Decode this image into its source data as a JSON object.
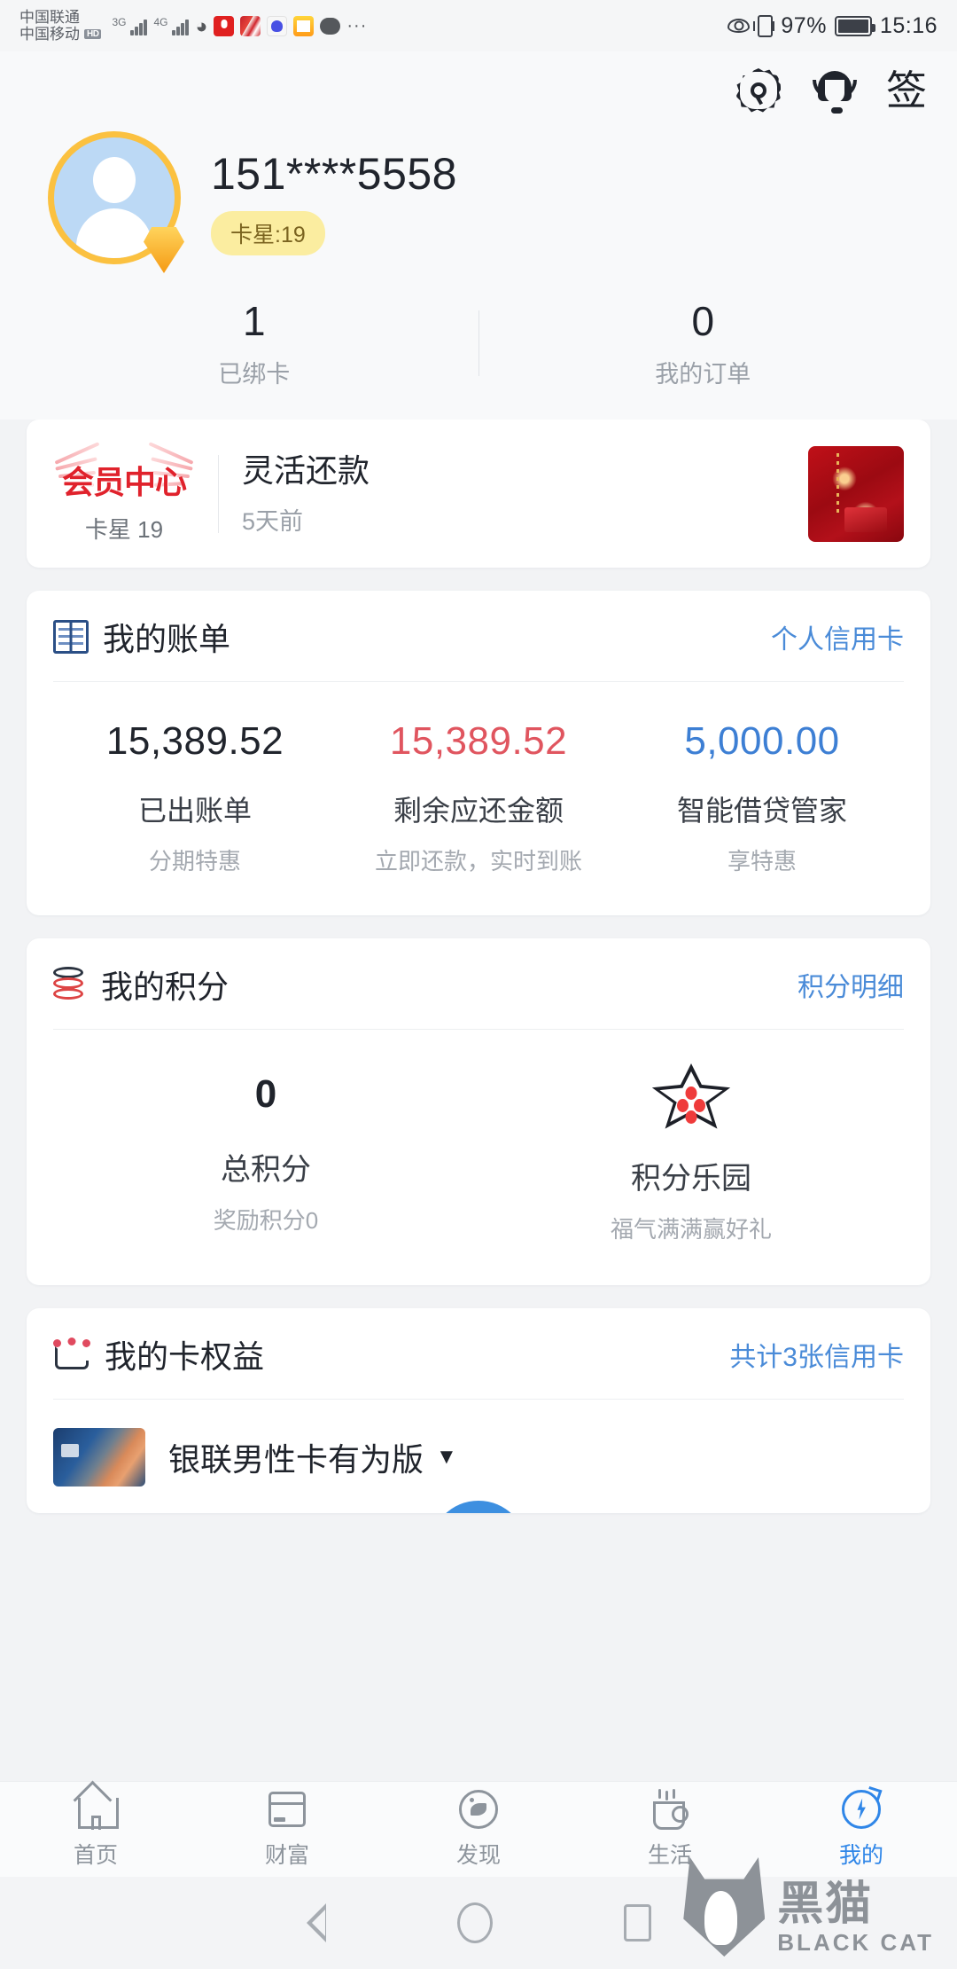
{
  "status_bar": {
    "carrier_1": "中国联通",
    "carrier_2": "中国移动",
    "hd_label": "HD",
    "net_1": "3G",
    "net_2": "4G",
    "net_2_sup": "+",
    "battery_percent": "97%",
    "time": "15:16",
    "more_dots": "···"
  },
  "header": {
    "sign_label": "签",
    "phone": "151****5558",
    "star_badge": "卡星:19"
  },
  "stats": [
    {
      "value": "1",
      "label": "已绑卡"
    },
    {
      "value": "0",
      "label": "我的订单"
    }
  ],
  "member_card": {
    "logo_text": "会员中心",
    "logo_sub": "卡星 19",
    "title": "灵活还款",
    "time": "5天前"
  },
  "bill_card": {
    "title": "我的账单",
    "link": "个人信用卡",
    "columns": [
      {
        "amount": "15,389.52",
        "label": "已出账单",
        "sub": "分期特惠",
        "color": "dark"
      },
      {
        "amount": "15,389.52",
        "label": "剩余应还金额",
        "sub": "立即还款，实时到账",
        "color": "red"
      },
      {
        "amount": "5,000.00",
        "label": "智能借贷管家",
        "sub": "享特惠",
        "color": "blue"
      }
    ]
  },
  "points_card": {
    "title": "我的积分",
    "link": "积分明细",
    "total_points": "0",
    "total_label": "总积分",
    "total_sub": "奖励积分0",
    "park_label": "积分乐园",
    "park_sub": "福气满满赢好礼"
  },
  "rights_card": {
    "title": "我的卡权益",
    "link": "共计3张信用卡",
    "card_name": "银联男性卡有为版",
    "caret": "▼"
  },
  "tabbar": [
    {
      "label": "首页",
      "icon": "home-icon",
      "active": false
    },
    {
      "label": "财富",
      "icon": "card-icon",
      "active": false
    },
    {
      "label": "发现",
      "icon": "discover-icon",
      "active": false
    },
    {
      "label": "生活",
      "icon": "cup-icon",
      "active": false
    },
    {
      "label": "我的",
      "icon": "user-icon",
      "active": true
    }
  ],
  "watermark": {
    "cn": "黑猫",
    "en": "BLACK CAT"
  },
  "colors": {
    "accent_blue": "#4a8bd8",
    "amount_red": "#e0555f",
    "amount_blue": "#3d7fd4",
    "badge_yellow": "#fbeda0",
    "avatar_ring": "#fbc140"
  }
}
